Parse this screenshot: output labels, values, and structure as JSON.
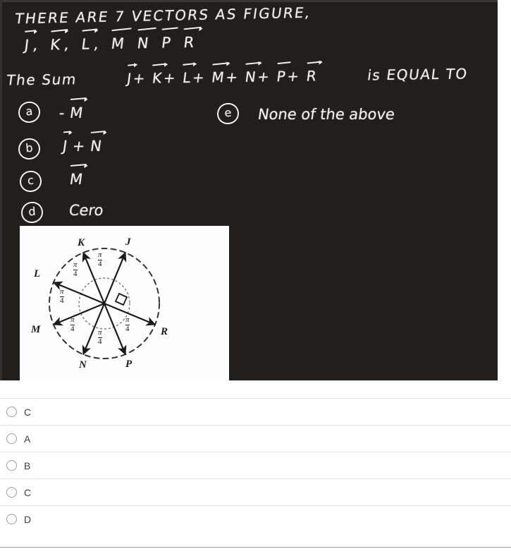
{
  "question": {
    "title_line": "THERE ARE 7 VECTORS AS FIGURE,",
    "vector_list": [
      "J",
      "K",
      "L",
      "M",
      "N",
      "P",
      "R"
    ],
    "sum_prefix": "The Sum",
    "sum_terms": [
      "J",
      "K",
      "L",
      "M",
      "N",
      "P",
      "R"
    ],
    "sum_suffix": "is  EQUAL TO",
    "plus": "+",
    "comma": ","
  },
  "handwritten_options": [
    {
      "marker": "a",
      "text": "- M",
      "has_vector": true,
      "vector_letter": "M",
      "prefix": "-"
    },
    {
      "marker": "b",
      "text": "J + N",
      "has_vector": true
    },
    {
      "marker": "c",
      "text": "M",
      "has_vector": true
    },
    {
      "marker": "d",
      "text": "Cero"
    },
    {
      "marker": "e",
      "text": "None of the above"
    }
  ],
  "figure": {
    "vectors": [
      {
        "label": "J",
        "angle_deg": 67.5
      },
      {
        "label": "K",
        "angle_deg": 112.5
      },
      {
        "label": "L",
        "angle_deg": 157.5
      },
      {
        "label": "M",
        "angle_deg": 202.5
      },
      {
        "label": "N",
        "angle_deg": 247.5
      },
      {
        "label": "P",
        "angle_deg": 292.5
      },
      {
        "label": "R",
        "angle_deg": 337.5
      }
    ],
    "angle_labels": [
      "π/4",
      "π/4",
      "π/4",
      "π/4",
      "π/4",
      "π/4"
    ],
    "angle_numerator": "π",
    "angle_denominator": "4",
    "right_angle_marker": true,
    "circle_style": "dashed"
  },
  "answers": {
    "options": [
      {
        "label": "C",
        "selected": false
      },
      {
        "label": "A",
        "selected": false
      },
      {
        "label": "B",
        "selected": false
      },
      {
        "label": "C",
        "selected": false
      },
      {
        "label": "D",
        "selected": false
      }
    ]
  },
  "colors": {
    "board_bg": "#211f1e",
    "chalk": "#f2f1ef",
    "figure_bg": "#fdfdfd",
    "ink": "#1b1b1b",
    "divider": "#e6e6e6",
    "radio_border": "#9aa0a6",
    "answer_text": "#3c4043"
  }
}
